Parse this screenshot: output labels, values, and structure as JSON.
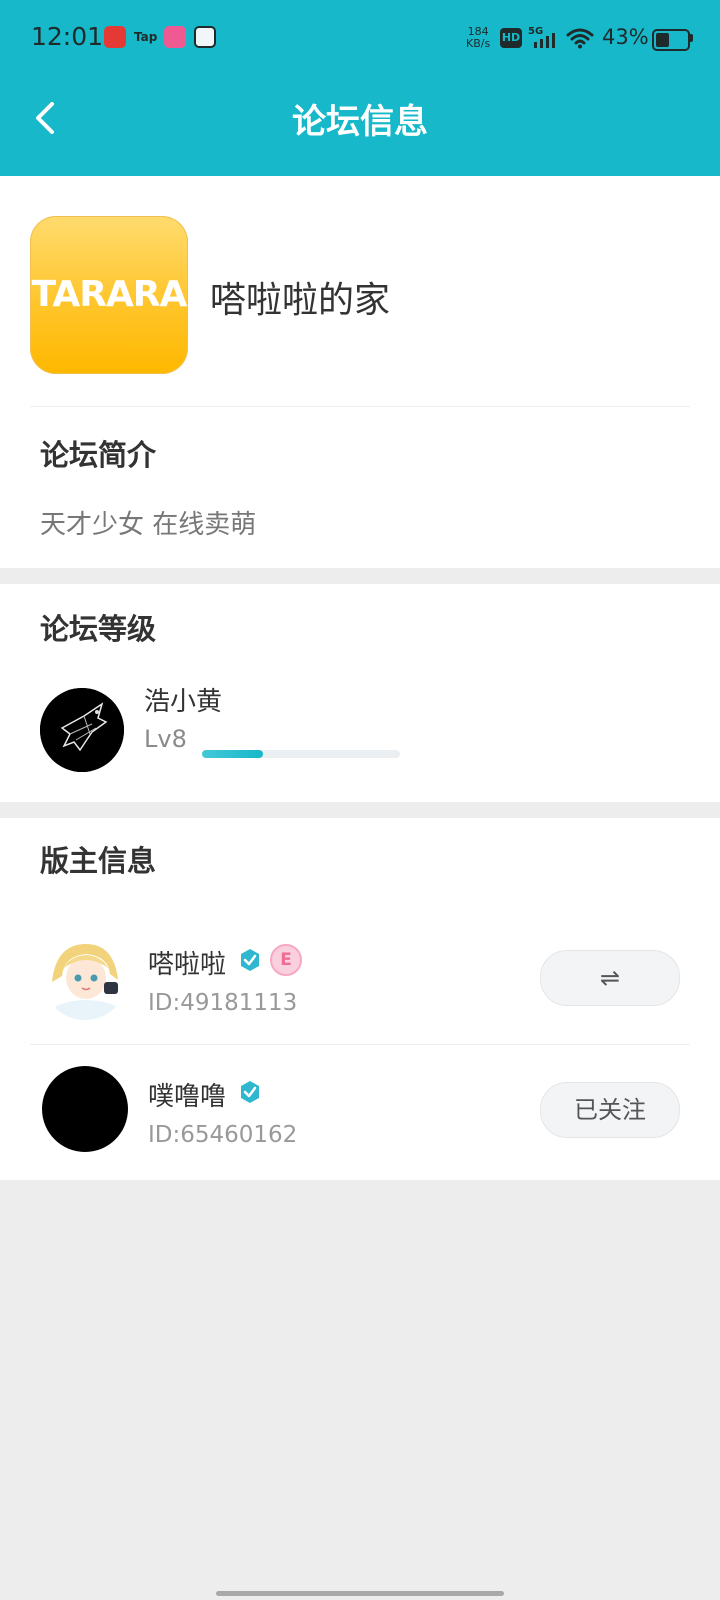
{
  "status_bar": {
    "time": "12:01",
    "notif_tap": "Tap",
    "net_speed_value": "184",
    "net_speed_unit": "KB/s",
    "hd": "HD",
    "network": "5G",
    "battery": "43%",
    "battery_level": 0.43
  },
  "header": {
    "back_icon": "chevron-left-icon",
    "title": "论坛信息"
  },
  "forum": {
    "logo_text": "TARARA",
    "name": "嗒啦啦的家",
    "intro_title": "论坛简介",
    "intro_text": "天才少女 在线卖萌"
  },
  "level": {
    "section_title": "论坛等级",
    "user_name": "浩小黄",
    "level_label": "Lv8",
    "progress": 0.31
  },
  "moderators": {
    "section_title": "版主信息",
    "items": [
      {
        "name": "嗒啦啦",
        "id": "ID:49181113",
        "button": "⇌",
        "button_icon": "swap-icon",
        "has_e_badge": true,
        "e_badge": "E"
      },
      {
        "name": "噗噜噜",
        "id": "ID:65460162",
        "button": "已关注",
        "has_e_badge": false
      }
    ]
  },
  "colors": {
    "accent": "#16b8c9",
    "background": "#ededed"
  }
}
